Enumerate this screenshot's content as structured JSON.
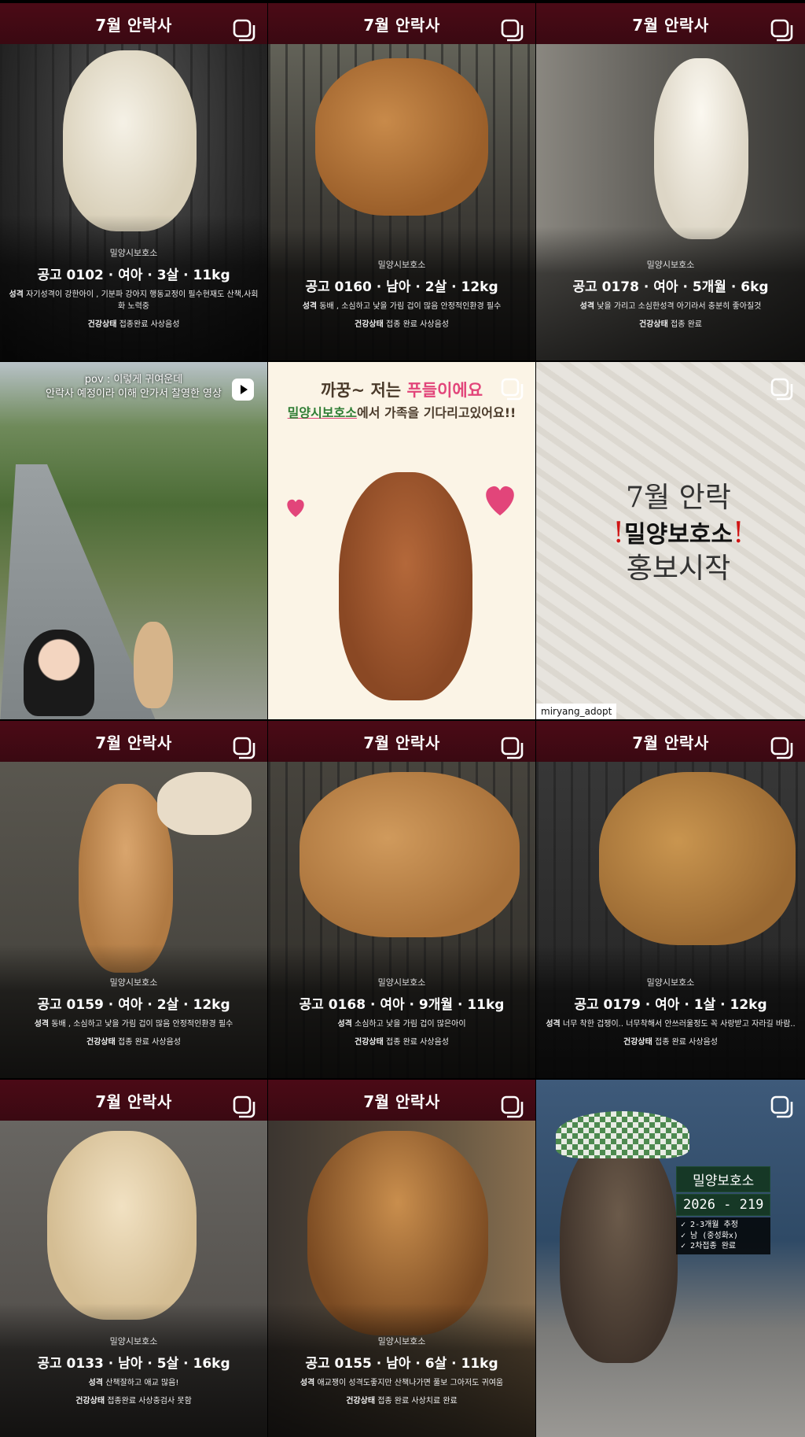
{
  "grid": {
    "posts": [
      {
        "banner": "7월 안락사",
        "shelter": "밀양시보호소",
        "main": "공고 0102 · 여아 · 3살 · 11kg",
        "desc_label": "성격",
        "desc": "자기성격이 강한아이 , 기분파 강아지 행동교정이 필수현재도 산책,사회화 노력중",
        "health_label": "건강상태",
        "health": "접종완료 사상음성"
      },
      {
        "banner": "7월 안락사",
        "shelter": "밀양시보호소",
        "main": "공고 0160 · 남아 · 2살 · 12kg",
        "desc_label": "성격",
        "desc": "동배 , 소심하고 낯을 가림 겁이 많음 안정적인환경 필수",
        "health_label": "건강상태",
        "health": "접종 완료 사상음성"
      },
      {
        "banner": "7월 안락사",
        "shelter": "밀양시보호소",
        "main": "공고 0178 · 여아 · 5개월 · 6kg",
        "desc_label": "성격",
        "desc": "낯을 가리고 소심한성격 아기라서 충분히 좋아질것",
        "health_label": "건강상태",
        "health": "접종 완료"
      },
      {
        "reel_caption_1": "pov : 이렇게 귀여운데",
        "reel_caption_2": "안락사 예정이라 이해 안가서 찰영한 영상"
      },
      {
        "poster_line1_a": "까꿍~ 저는 ",
        "poster_line1_b": "푸들이에요",
        "poster_line2_a": "밀양시보호소",
        "poster_line2_b": "에서 가족을 기다리고있어요!!"
      },
      {
        "sand_line1": "7월 안락",
        "sand_bang": "!",
        "sand_line2": "밀양보호소",
        "sand_line3": "홍보시작",
        "watermark": "miryang_adopt"
      },
      {
        "banner": "7월 안락사",
        "shelter": "밀양시보호소",
        "main": "공고 0159 · 여아 · 2살 · 12kg",
        "desc_label": "성격",
        "desc": "동배 , 소심하고 낯을 가림 겁이 많음 안정적인환경 필수",
        "health_label": "건강상태",
        "health": "접종 완료 사상음성"
      },
      {
        "banner": "7월 안락사",
        "shelter": "밀양시보호소",
        "main": "공고 0168 · 여아 · 9개월 · 11kg",
        "desc_label": "성격",
        "desc": "소심하고 낯을 가림 겁이 많은아이",
        "health_label": "건강상태",
        "health": "접종 완료 사상음성"
      },
      {
        "banner": "7월 안락사",
        "shelter": "밀양시보호소",
        "main": "공고 0179 · 여아 · 1살 · 12kg",
        "desc_label": "성격",
        "desc": "너무 착한 겁쟁이.. 너무착해서 안쓰러울정도 꼭 사랑받고 자라길 바람..",
        "health_label": "건강상태",
        "health": "접종 완료 사상음성"
      },
      {
        "banner": "7월 안락사",
        "shelter": "밀양시보호소",
        "main": "공고 0133 · 남아 · 5살 · 16kg",
        "desc_label": "성격",
        "desc": "산책잘하고 애교 많음!",
        "health_label": "건강상태",
        "health": "접종완료 사상충검사 못함"
      },
      {
        "banner": "7월 안락사",
        "shelter": "밀양시보호소",
        "main": "공고 0155 · 남아 · 6살 · 11kg",
        "desc_label": "성격",
        "desc": "애교쟁이 성격도좋지만 산책나가면 풀보 그아저도 귀여움",
        "health_label": "건강상태",
        "health": "접종 완료 사상치료 완료"
      },
      {
        "badge_1": "밀양보호소",
        "badge_2": "2026 - 219",
        "badge_list_1": "2-3개월 추정",
        "badge_list_2": "남 (중성화x)",
        "badge_list_3": "2차접종 완료"
      }
    ]
  },
  "icons": {
    "carousel": "carousel-icon",
    "reel": "reel-icon"
  },
  "colors": {
    "banner": "#4b0a16",
    "poster_pink": "#e2457a",
    "badge_green": "#163826"
  }
}
